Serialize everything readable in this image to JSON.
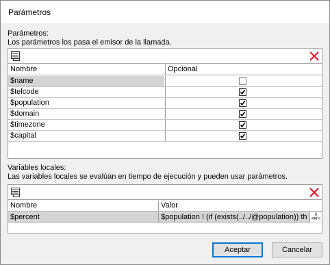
{
  "window": {
    "title": "Parámetros"
  },
  "params": {
    "label": "Parámetros:",
    "description": "Los parámetros los pasa el emisor de la llamada.",
    "toolbar": {
      "add_icon": "list-add-icon",
      "delete_icon": "red-x-delete-icon"
    },
    "columns": {
      "name": "Nombre",
      "optional": "Opcional"
    },
    "rows": [
      {
        "name": "$name",
        "optional": false
      },
      {
        "name": "$telcode",
        "optional": true
      },
      {
        "name": "$population",
        "optional": true
      },
      {
        "name": "$domain",
        "optional": true
      },
      {
        "name": "$timezone",
        "optional": true
      },
      {
        "name": "$capital",
        "optional": true
      }
    ]
  },
  "locals": {
    "label": "Variables locales:",
    "description": "Las variables locales se evalúan en tiempo de ejecución y pueden usar parámetros.",
    "columns": {
      "name": "Nombre",
      "value": "Valor"
    },
    "rows": [
      {
        "name": "$percent",
        "value": "$population ! (if (exists(../../@population)) th",
        "xpath_label": "PATH"
      }
    ]
  },
  "buttons": {
    "ok": "Aceptar",
    "cancel": "Cancelar"
  },
  "colors": {
    "delete": "#e81123",
    "selection": "#d4d4d4",
    "accent": "#0078d7"
  }
}
